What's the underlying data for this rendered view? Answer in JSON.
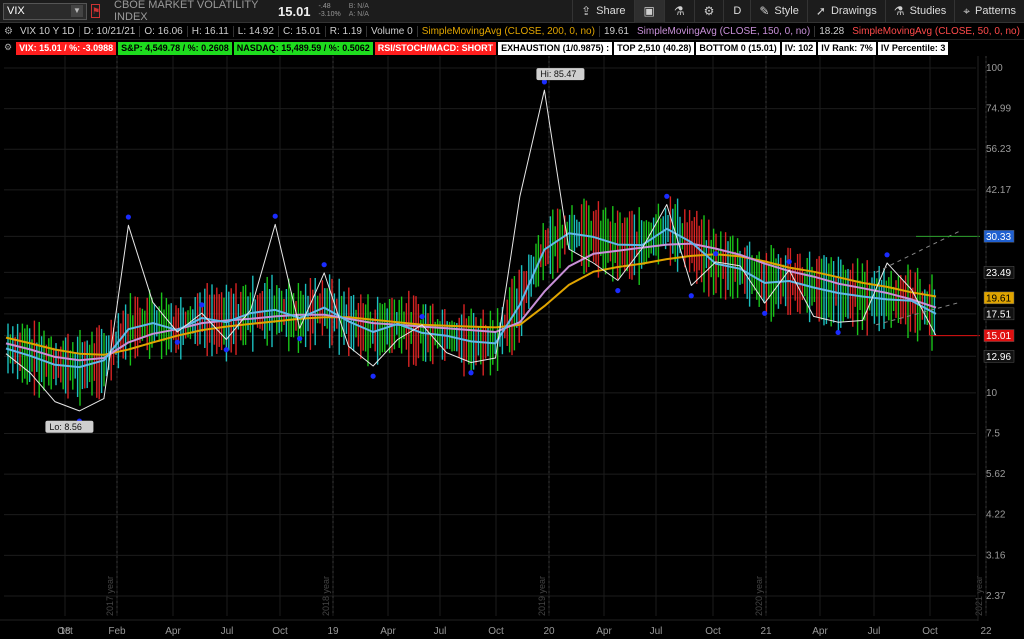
{
  "toolbar": {
    "symbol": "VIX",
    "description": "CBOE MARKET VOLATILITY INDEX",
    "last": "15.01",
    "change_abs": "-.48",
    "change_pct": "-3.10%",
    "bid": "B: N/A",
    "ask": "A: N/A",
    "buttons": {
      "share": "Share",
      "period": "D",
      "style": "Style",
      "drawings": "Drawings",
      "studies": "Studies",
      "patterns": "Patterns"
    }
  },
  "info_row": {
    "period": "VIX 10 Y 1D",
    "date": "D: 10/21/21",
    "open": "O: 16.06",
    "high": "H: 16.11",
    "low": "L: 14.92",
    "close": "C: 15.01",
    "range": "R: 1.19",
    "volume_label": "Volume",
    "volume_value": "0",
    "sma200_label": "SimpleMovingAvg (CLOSE, 200, 0, no)",
    "sma200_value": "19.61",
    "sma150_label": "SimpleMovingAvg (CLOSE, 150, 0, no)",
    "sma150_value": "18.28",
    "sma50_label": "SimpleMovingAvg (CLOSE, 50, 0, no)",
    "ellipsis": "..."
  },
  "study_tags": [
    {
      "text": "VIX: 15.01 / %: -3.0988",
      "color": "red"
    },
    {
      "text": "S&P: 4,549.78 / %: 0.2608",
      "color": "green"
    },
    {
      "text": "NASDAQ: 15,489.59 / %: 0.5062",
      "color": "green"
    },
    {
      "text": "RSI/STOCH/MACD: SHORT",
      "color": "red"
    },
    {
      "text": "EXHAUSTION (1/0.9875) :",
      "color": "white"
    },
    {
      "text": "TOP 2,510 (40.28)",
      "color": "white"
    },
    {
      "text": "BOTTOM 0 (15.01)",
      "color": "white"
    },
    {
      "text": "IV: 102",
      "color": "white"
    },
    {
      "text": "IV Rank: 7%",
      "color": "white"
    },
    {
      "text": "IV Percentile: 3",
      "color": "white"
    }
  ],
  "chart_data": {
    "type": "line",
    "y_scale": "log",
    "y_ticks": [
      "100",
      "74.99",
      "56.23",
      "42.17",
      "30.33",
      "23.49",
      "19.61",
      "17.51",
      "15.01",
      "12.96",
      "10",
      "7.5",
      "5.62",
      "4.22",
      "3.16",
      "2.37"
    ],
    "x_ticks": [
      "Oct",
      "18",
      "Feb",
      "Apr",
      "Jul",
      "Oct",
      "19",
      "Apr",
      "Jul",
      "Oct",
      "20",
      "Apr",
      "Jul",
      "Oct",
      "21",
      "Apr",
      "Jul",
      "Oct",
      "22"
    ],
    "year_markers": [
      "2017 year",
      "2018 year",
      "2019 year",
      "2020 year",
      "2021 year"
    ],
    "annotations": [
      {
        "text": "Hi: 85.47",
        "value": 85.47
      },
      {
        "text": "Lo: 8.56",
        "value": 8.56
      }
    ],
    "price_tags": [
      {
        "text": "30.33",
        "value": 30.33,
        "color": "#2060d0"
      },
      {
        "text": "23.49",
        "value": 23.49,
        "color": "#111111"
      },
      {
        "text": "19.61",
        "value": 19.61,
        "color": "#e0a400"
      },
      {
        "text": "17.51",
        "value": 17.51,
        "color": "#111111"
      },
      {
        "text": "15.01",
        "value": 15.01,
        "color": "#e01010"
      },
      {
        "text": "12.96",
        "value": 12.96,
        "color": "#111111"
      }
    ],
    "series": [
      {
        "name": "SimpleMovingAvg (CLOSE, 200, 0, no)",
        "color": "#e0a400",
        "values": [
          14.8,
          14.2,
          13.6,
          13.2,
          13.1,
          13.6,
          14.3,
          15.0,
          15.6,
          16.0,
          16.3,
          16.6,
          16.9,
          17.1,
          17.1,
          16.8,
          16.5,
          16.2,
          16.1,
          16.0,
          15.9,
          16.2,
          18.5,
          21.5,
          23.6,
          24.4,
          25.0,
          25.8,
          26.4,
          26.7,
          26.3,
          25.4,
          24.3,
          23.6,
          22.7,
          21.8,
          21.2,
          20.4,
          19.8
        ]
      },
      {
        "name": "SimpleMovingAvg (CLOSE, 150, 0, no)",
        "color": "#c890d8",
        "values": [
          14.2,
          13.6,
          12.9,
          12.6,
          12.8,
          14.3,
          15.2,
          15.7,
          16.4,
          16.7,
          16.9,
          17.2,
          17.4,
          17.4,
          16.9,
          16.4,
          16.2,
          16.0,
          15.8,
          15.6,
          15.4,
          16.5,
          20.5,
          24.5,
          26.8,
          27.4,
          28.0,
          28.6,
          28.8,
          27.8,
          26.6,
          25.0,
          23.7,
          22.8,
          21.7,
          21.0,
          20.3,
          19.4,
          18.3
        ]
      },
      {
        "name": "SimpleMovingAvg (CLOSE, 50, 0, no)",
        "color": "#60b8e8",
        "values": [
          13.7,
          13.0,
          12.2,
          12.0,
          12.6,
          15.7,
          16.4,
          15.6,
          17.0,
          16.5,
          17.6,
          18.0,
          17.0,
          18.3,
          16.6,
          15.4,
          16.3,
          15.3,
          15.0,
          14.4,
          14.2,
          18.7,
          27.6,
          31.0,
          30.2,
          28.6,
          28.5,
          32.0,
          29.1,
          25.0,
          24.1,
          21.8,
          22.1,
          21.1,
          20.3,
          19.8,
          19.4,
          19.2,
          17.5
        ]
      },
      {
        "name": "VIX",
        "color": "#e8e8e8",
        "values": [
          13.2,
          11.5,
          9.4,
          8.8,
          9.6,
          32.8,
          19.0,
          15.4,
          17.6,
          14.6,
          18.0,
          33.0,
          15.8,
          23.4,
          13.9,
          12.1,
          14.6,
          16.2,
          13.3,
          12.4,
          12.8,
          40.3,
          85.5,
          27.7,
          25.1,
          22.2,
          27.9,
          38.0,
          21.4,
          25.3,
          24.6,
          18.9,
          23.9,
          17.2,
          16.5,
          16.7,
          25.1,
          20.8,
          15.0
        ]
      }
    ]
  }
}
